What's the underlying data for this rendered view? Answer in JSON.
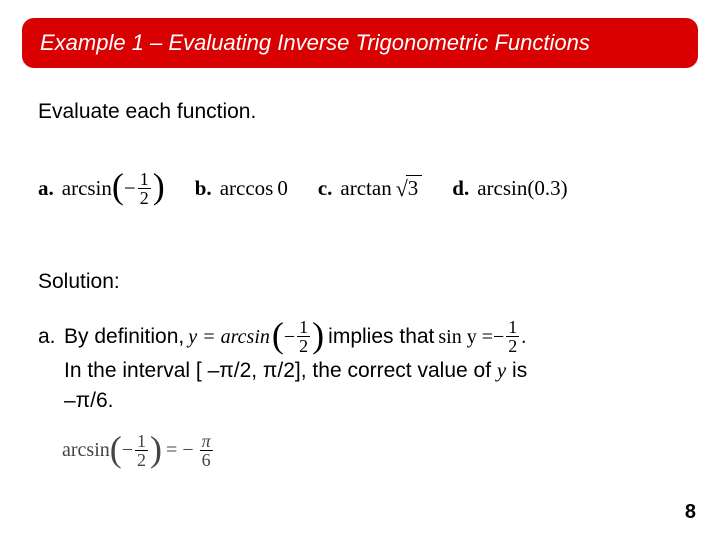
{
  "title": "Example 1 – Evaluating Inverse Trigonometric Functions",
  "instruction": "Evaluate each function.",
  "problems": {
    "a": {
      "label": "a.",
      "func": "arcsin",
      "arg_prefix": "−",
      "arg_num": "1",
      "arg_den": "2"
    },
    "b": {
      "label": "b.",
      "func": "arccos",
      "arg": "0"
    },
    "c": {
      "label": "c.",
      "func": "arctan",
      "arg_rad": "3"
    },
    "d": {
      "label": "d.",
      "func": "arcsin",
      "arg": "(0.3)"
    }
  },
  "solution": {
    "heading": "Solution:",
    "a": {
      "label": "a.",
      "text1": "By definition,",
      "eq1_lhs": "y = arcsin",
      "eq1_prefix": "−",
      "eq1_num": "1",
      "eq1_den": "2",
      "text2": "implies that",
      "eq2_lhs": "sin y = ",
      "eq2_prefix": "−",
      "eq2_num": "1",
      "eq2_den": "2",
      "eq2_suffix": ".",
      "text3_a": "In the interval [ –π/2, π/2], the correct value of ",
      "text3_y": "y",
      "text3_b": " is",
      "text4": "–π/6.",
      "final_func": "arcsin",
      "final_prefix": "−",
      "final_num": "1",
      "final_den": "2",
      "final_eq": " = −",
      "final_rnum": "π",
      "final_rden": "6"
    }
  },
  "page": "8"
}
